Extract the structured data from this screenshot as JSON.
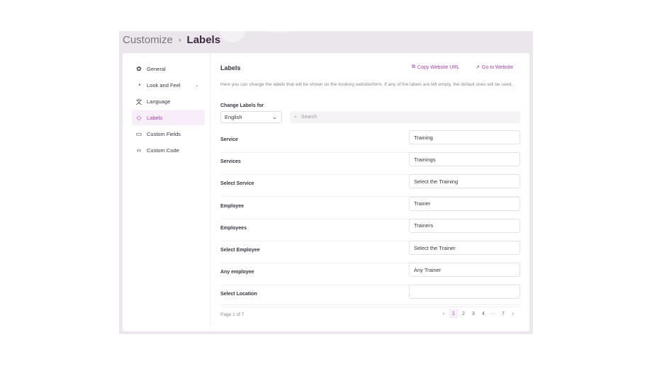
{
  "breadcrumb": {
    "parent": "Customize",
    "current": "Labels"
  },
  "sidebar": {
    "items": [
      {
        "label": "General",
        "icon": "✿"
      },
      {
        "label": "Look and Feel",
        "icon": "◔"
      },
      {
        "label": "Language",
        "icon": "文"
      },
      {
        "label": "Labels",
        "icon": "◇"
      },
      {
        "label": "Custom Fields",
        "icon": "▭"
      },
      {
        "label": "Custom Code",
        "icon": "‹›"
      }
    ]
  },
  "main": {
    "title": "Labels",
    "copy_url": "Copy Website URL",
    "go_website": "Go to Website",
    "description": "Here you can change the labels that will be shown on the booking website/form. If any of the labels are left empty, the default ones will be used.",
    "change_labels_for": "Change Labels for",
    "language": "English",
    "search_placeholder": "Search",
    "rows": [
      {
        "label": "Service",
        "value": "Training"
      },
      {
        "label": "Services",
        "value": "Trainings"
      },
      {
        "label": "Select Service",
        "value": "Select the Training"
      },
      {
        "label": "Employee",
        "value": "Trainer"
      },
      {
        "label": "Employees",
        "value": "Trainers"
      },
      {
        "label": "Select Employee",
        "value": "Select the Trainer"
      },
      {
        "label": "Any employee",
        "value": "Any Trainer"
      },
      {
        "label": "Select Location",
        "value": ""
      }
    ]
  },
  "pagination": {
    "info": "Page 1 of 7",
    "prev": "‹",
    "next": "›",
    "pages": [
      "1",
      "2",
      "3",
      "4",
      "···",
      "7"
    ]
  },
  "colors": {
    "accent": "#a23fb0",
    "frame": "#ebe6ec"
  }
}
